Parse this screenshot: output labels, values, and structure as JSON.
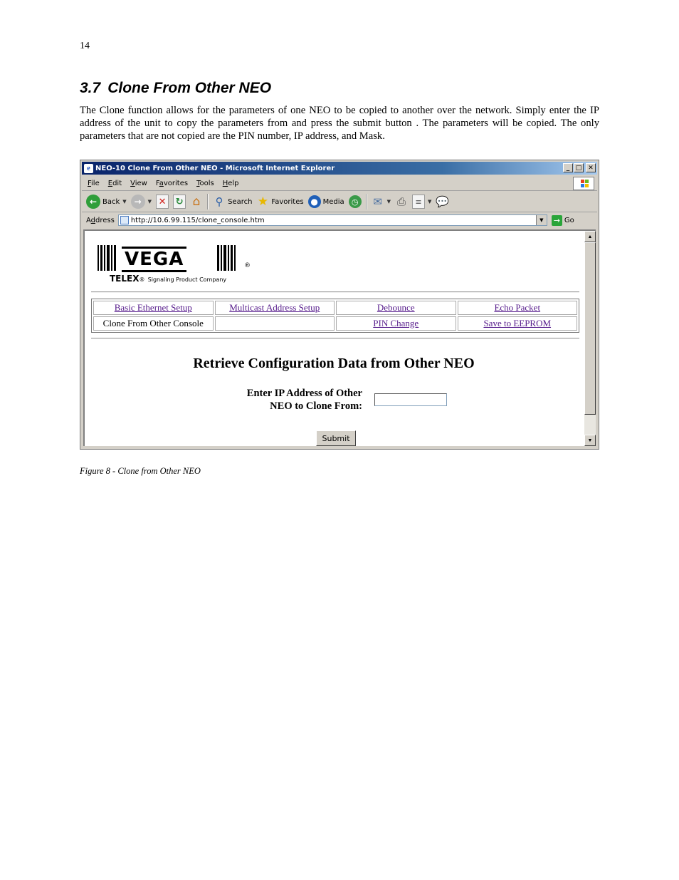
{
  "page_number": "14",
  "section": {
    "number": "3.7",
    "title": "Clone From Other NEO",
    "paragraph": "The Clone function allows for the parameters of one NEO to be copied to another over the network.  Simply enter the IP address of the unit to copy the parameters from and press the submit button .  The parameters will be copied.  The only parameters that are not copied are the PIN number, IP address, and Mask."
  },
  "caption": "Figure 8 - Clone from Other NEO",
  "browser": {
    "window_title": "NEO-10 Clone From Other NEO - Microsoft Internet Explorer",
    "menu": [
      {
        "acc": "F",
        "rest": "ile"
      },
      {
        "acc": "E",
        "rest": "dit"
      },
      {
        "acc": "V",
        "rest": "iew"
      },
      {
        "acc": "a",
        "pre": "F",
        "rest": "vorites"
      },
      {
        "acc": "T",
        "rest": "ools"
      },
      {
        "acc": "H",
        "rest": "elp"
      }
    ],
    "toolbar": {
      "back": "Back",
      "search": "Search",
      "favorites": "Favorites",
      "media": "Media"
    },
    "address_label_acc": "d",
    "address_label_pre": "A",
    "address_label_rest": "dress",
    "url": "http://10.6.99.115/clone_console.htm",
    "go": "Go"
  },
  "content": {
    "logo": {
      "word": "VEGA",
      "reg": "®",
      "telex": "TELEX",
      "telex_reg": "®",
      "tagline": "Signaling Product Company"
    },
    "nav": [
      [
        "Basic Ethernet Setup",
        "Multicast Address Setup",
        "Debounce",
        "Echo Packet"
      ],
      [
        "Clone From Other Console",
        "",
        "PIN Change",
        "Save to EEPROM"
      ]
    ],
    "heading": "Retrieve Configuration Data from Other NEO",
    "ip_label_line1": "Enter IP Address of Other",
    "ip_label_line2": "NEO to Clone From:",
    "ip_value": "",
    "submit": "Submit"
  }
}
